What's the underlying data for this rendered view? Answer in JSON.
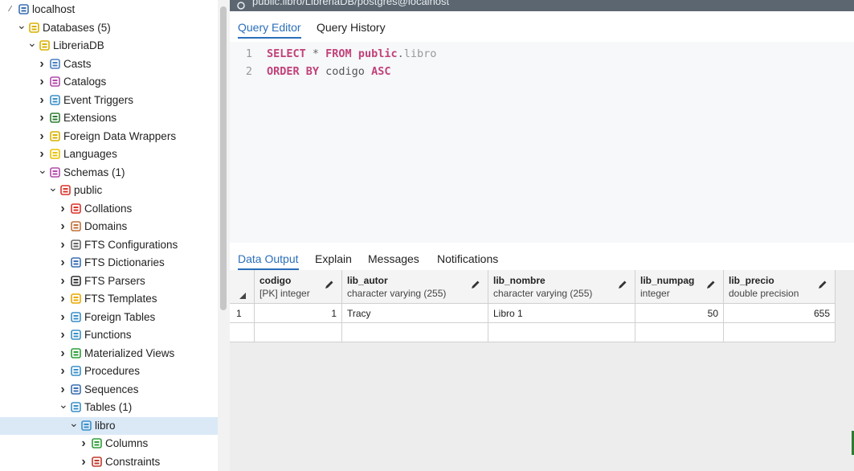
{
  "colors": {
    "accent": "#2a6ebb",
    "selected_row": "#dbe9f7",
    "keyword": "#c2417a",
    "connection_bar": "#5b6670"
  },
  "tree": [
    {
      "label": "localhost",
      "icon": "elephant-server-icon",
      "chevron": "open-small",
      "selected": false
    },
    {
      "label": "Databases (5)",
      "icon": "databases-icon",
      "chevron": "down",
      "selected": false
    },
    {
      "label": "LibreriaDB",
      "icon": "database-icon",
      "chevron": "down",
      "selected": false
    },
    {
      "label": "Casts",
      "icon": "casts-icon",
      "chevron": "right",
      "selected": false
    },
    {
      "label": "Catalogs",
      "icon": "catalogs-icon",
      "chevron": "right",
      "selected": false
    },
    {
      "label": "Event Triggers",
      "icon": "event-trigger-icon",
      "chevron": "right",
      "selected": false
    },
    {
      "label": "Extensions",
      "icon": "extensions-icon",
      "chevron": "right",
      "selected": false
    },
    {
      "label": "Foreign Data Wrappers",
      "icon": "foreign-data-wrapper-icon",
      "chevron": "right",
      "selected": false
    },
    {
      "label": "Languages",
      "icon": "languages-icon",
      "chevron": "right",
      "selected": false
    },
    {
      "label": "Schemas (1)",
      "icon": "schemas-icon",
      "chevron": "down",
      "selected": false
    },
    {
      "label": "public",
      "icon": "schema-icon",
      "chevron": "down",
      "selected": false
    },
    {
      "label": "Collations",
      "icon": "collations-icon",
      "chevron": "right",
      "selected": false
    },
    {
      "label": "Domains",
      "icon": "domains-icon",
      "chevron": "right",
      "selected": false
    },
    {
      "label": "FTS Configurations",
      "icon": "fts-configuration-icon",
      "chevron": "right",
      "selected": false
    },
    {
      "label": "FTS Dictionaries",
      "icon": "fts-dictionary-icon",
      "chevron": "right",
      "selected": false
    },
    {
      "label": "FTS Parsers",
      "icon": "fts-parser-icon",
      "chevron": "right",
      "selected": false
    },
    {
      "label": "FTS Templates",
      "icon": "fts-template-icon",
      "chevron": "right",
      "selected": false
    },
    {
      "label": "Foreign Tables",
      "icon": "foreign-table-icon",
      "chevron": "right",
      "selected": false
    },
    {
      "label": "Functions",
      "icon": "functions-icon",
      "chevron": "right",
      "selected": false
    },
    {
      "label": "Materialized Views",
      "icon": "materialized-view-icon",
      "chevron": "right",
      "selected": false
    },
    {
      "label": "Procedures",
      "icon": "procedures-icon",
      "chevron": "right",
      "selected": false
    },
    {
      "label": "Sequences",
      "icon": "sequences-icon",
      "chevron": "right",
      "selected": false
    },
    {
      "label": "Tables (1)",
      "icon": "tables-icon",
      "chevron": "down",
      "selected": false
    },
    {
      "label": "libro",
      "icon": "table-icon",
      "chevron": "down",
      "selected": true
    },
    {
      "label": "Columns",
      "icon": "columns-icon",
      "chevron": "right",
      "selected": false
    },
    {
      "label": "Constraints",
      "icon": "constraints-icon",
      "chevron": "right",
      "selected": false
    }
  ],
  "connection": {
    "title": "public.libro/LibreriaDB/postgres@localhost"
  },
  "editor_tabs": [
    "Query Editor",
    "Query History"
  ],
  "editor": {
    "lines": [
      {
        "num": "1",
        "tokens": [
          [
            "kw",
            "SELECT"
          ],
          [
            "op",
            " * "
          ],
          [
            "kw",
            "FROM"
          ],
          [
            "sc",
            " public"
          ],
          [
            "op",
            "."
          ],
          [
            "tb",
            "libro"
          ]
        ]
      },
      {
        "num": "2",
        "tokens": [
          [
            "kw",
            "ORDER BY"
          ],
          [
            "id",
            " codigo "
          ],
          [
            "kw",
            "ASC"
          ]
        ]
      }
    ]
  },
  "result_tabs": [
    "Data Output",
    "Explain",
    "Messages",
    "Notifications"
  ],
  "grid": {
    "columns": [
      {
        "name": "codigo",
        "type": "[PK] integer"
      },
      {
        "name": "lib_autor",
        "type": "character varying (255)"
      },
      {
        "name": "lib_nombre",
        "type": "character varying (255)"
      },
      {
        "name": "lib_numpag",
        "type": "integer"
      },
      {
        "name": "lib_precio",
        "type": "double precision"
      }
    ],
    "rows": [
      {
        "row_num": "1",
        "values": [
          "1",
          "Tracy",
          "Libro 1",
          "50",
          "655"
        ]
      }
    ]
  }
}
